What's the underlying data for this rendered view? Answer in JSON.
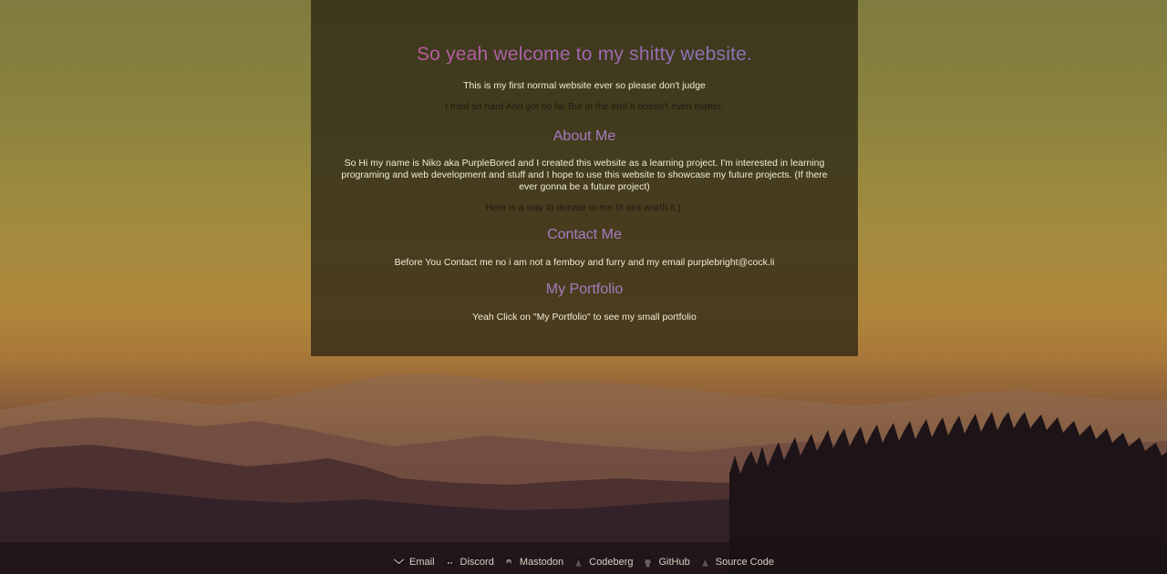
{
  "header": {
    "title": "So yeah welcome to my shitty website.",
    "tagline": "This is my first normal website ever so please don't judge",
    "lyric": "I tried so hard And got so far But in the end It doesn't even matter."
  },
  "about": {
    "heading": "About Me",
    "text": "So Hi my name is Niko aka PurpleBored and I created this website as a learning project. I'm interested in learning programing and web development and stuff and I hope to use this website to showcase my future projects. (If there ever gonna be a future project)",
    "donate": "Here is a way to donate to me (it aint worth it.)."
  },
  "contact": {
    "heading": "Contact Me",
    "text": "Before You Contact me no i am not a femboy and furry and my email purplebright@cock.li"
  },
  "portfolio": {
    "heading": "My Portfolio",
    "text": "Yeah Click on \"My Portfolio\" to see my small portfolio"
  },
  "footer": {
    "links": [
      {
        "label": "Email",
        "icon": "envelope-icon"
      },
      {
        "label": "Discord",
        "icon": "discord-icon"
      },
      {
        "label": "Mastodon",
        "icon": "mastodon-icon"
      },
      {
        "label": "Codeberg",
        "icon": "codeberg-icon"
      },
      {
        "label": "GitHub",
        "icon": "github-icon"
      },
      {
        "label": "Source Code",
        "icon": "source-code-icon"
      }
    ]
  },
  "colors": {
    "heading_accent": "#a77ac0",
    "title_gradient_start": "#c9568f",
    "title_gradient_end": "#6f84bf",
    "panel_background": "rgba(40,35,20,0.75)"
  }
}
